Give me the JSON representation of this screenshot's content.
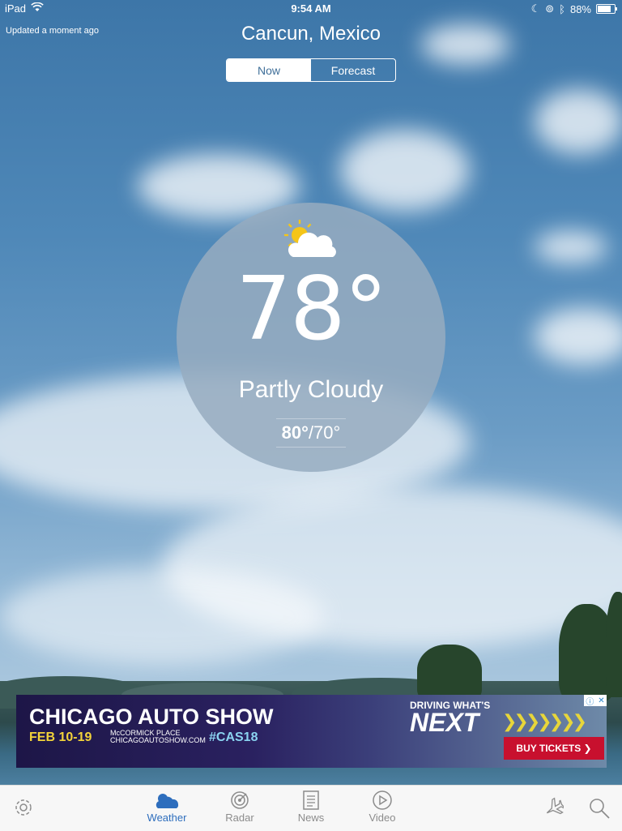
{
  "status_bar": {
    "device": "iPad",
    "time": "9:54 AM",
    "battery": "88%",
    "battery_level": 0.88,
    "icons": [
      "wifi-icon",
      "moon-icon",
      "lock-rotation-icon",
      "bluetooth-icon",
      "battery-icon"
    ]
  },
  "header": {
    "updated": "Updated a moment ago",
    "city": "Cancun, Mexico",
    "tabs": [
      {
        "label": "Now",
        "active": true
      },
      {
        "label": "Forecast",
        "active": false
      }
    ]
  },
  "current": {
    "icon": "partly-cloudy-icon",
    "temperature": "78°",
    "condition": "Partly Cloudy",
    "high": "80°",
    "low": "/70°"
  },
  "ad": {
    "title": "CHICAGO AUTO SHOW",
    "dates": "FEB 10-19",
    "venue_line1": "McCORMICK PLACE",
    "venue_line2": "CHICAGOAUTOSHOW.COM",
    "hashtag": "#CAS18",
    "tagline": "DRIVING WHAT'S",
    "headline": "NEXT",
    "chevrons": "❯❯❯❯❯❯❯",
    "button": "BUY TICKETS ❯",
    "ad_choice_icon": "ⓘ",
    "close_icon": "✕"
  },
  "tabbar": {
    "items": [
      {
        "label": "Weather",
        "icon": "weather-icon",
        "active": true
      },
      {
        "label": "Radar",
        "icon": "radar-icon",
        "active": false
      },
      {
        "label": "News",
        "icon": "news-icon",
        "active": false
      },
      {
        "label": "Video",
        "icon": "video-icon",
        "active": false
      }
    ],
    "left_icon": "settings-icon",
    "right_icons": [
      "airplane-icon",
      "search-icon"
    ]
  },
  "colors": {
    "accent": "#2e6ebd",
    "sky": "#4f82ad",
    "ad_button": "#c8102e",
    "tab_inactive": "#8c8c8c"
  }
}
